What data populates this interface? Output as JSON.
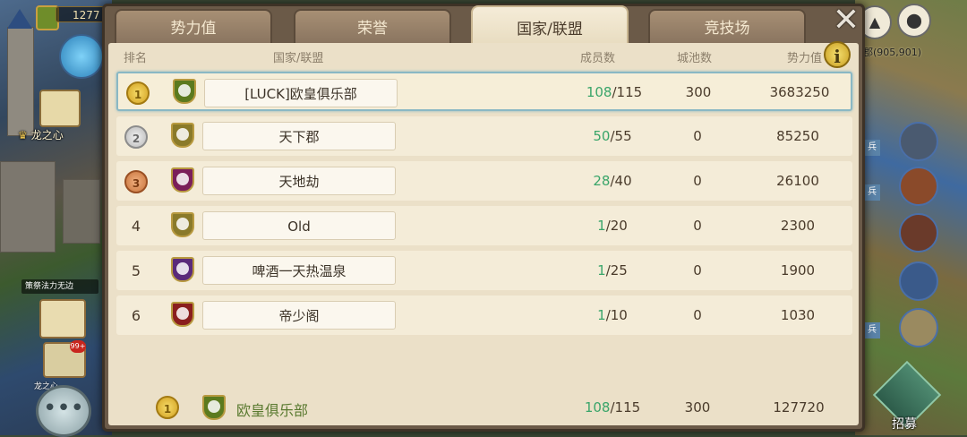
{
  "hud_left": {
    "resource_value": "1277",
    "location_label": "龙之心",
    "tip_text": "策祭法力无边",
    "badge_count": "99+",
    "small_label": "龙之心"
  },
  "hud_right": {
    "coords": "郡(905,901)",
    "troop_label": "兵",
    "recruit_label": "招募"
  },
  "tabs": [
    {
      "label": "势力值",
      "active": false
    },
    {
      "label": "荣誉",
      "active": false
    },
    {
      "label": "国家/联盟",
      "active": true
    },
    {
      "label": "竞技场",
      "active": false
    }
  ],
  "close_symbol": "✕",
  "info_symbol": "i",
  "headers": {
    "rank": "排名",
    "name": "国家/联盟",
    "members": "成员数",
    "cities": "城池数",
    "power": "势力值"
  },
  "rows": [
    {
      "rank": "1",
      "medal": "gold",
      "flag_color": "#5b7a1e",
      "name": "[LUCK]欧皇俱乐部",
      "members_current": "108",
      "members_max": "/115",
      "cities": "300",
      "power": "3683250"
    },
    {
      "rank": "2",
      "medal": "silver",
      "flag_color": "#8a7a2a",
      "name": "天下郡",
      "members_current": "50",
      "members_max": "/55",
      "cities": "0",
      "power": "85250"
    },
    {
      "rank": "3",
      "medal": "bronze",
      "flag_color": "#7a1e5a",
      "name": "天地劫",
      "members_current": "28",
      "members_max": "/40",
      "cities": "0",
      "power": "26100"
    },
    {
      "rank": "4",
      "medal": "",
      "flag_color": "#8a7a2a",
      "name": "Old",
      "members_current": "1",
      "members_max": "/20",
      "cities": "0",
      "power": "2300"
    },
    {
      "rank": "5",
      "medal": "",
      "flag_color": "#5a2a7a",
      "name": "啤酒一天热温泉",
      "members_current": "1",
      "members_max": "/25",
      "cities": "0",
      "power": "1900"
    },
    {
      "rank": "6",
      "medal": "",
      "flag_color": "#8a1e1e",
      "name": "帝少阁",
      "members_current": "1",
      "members_max": "/10",
      "cities": "0",
      "power": "1030"
    }
  ],
  "footer": {
    "rank": "1",
    "medal": "gold",
    "flag_color": "#5b7a1e",
    "name": "欧皇俱乐部",
    "members_current": "108",
    "members_max": "/115",
    "cities": "300",
    "power": "127720"
  }
}
